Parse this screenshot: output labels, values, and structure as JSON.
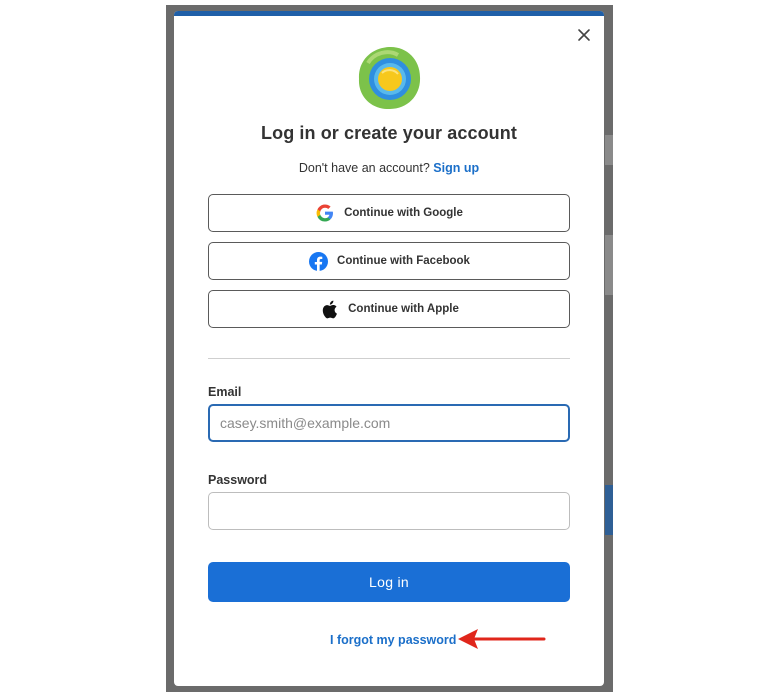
{
  "modal": {
    "title": "Log in or create your account",
    "signup_prompt": "Don't have an account?",
    "signup_link": "Sign up",
    "close_icon": "close-icon",
    "logo_icon": "brand-logo"
  },
  "social": [
    {
      "label": "Continue with Google",
      "icon": "google-icon"
    },
    {
      "label": "Continue with Facebook",
      "icon": "facebook-icon"
    },
    {
      "label": "Continue with Apple",
      "icon": "apple-icon"
    }
  ],
  "form": {
    "email_label": "Email",
    "email_placeholder": "casey.smith@example.com",
    "password_label": "Password",
    "password_value": "",
    "login_label": "Log in",
    "forgot_label": "I forgot my password"
  },
  "annotation": {
    "arrow_color": "#e0261b"
  },
  "colors": {
    "primary": "#1a6fd6",
    "link": "#1b6fc9",
    "topbar": "#1f5fa8"
  }
}
